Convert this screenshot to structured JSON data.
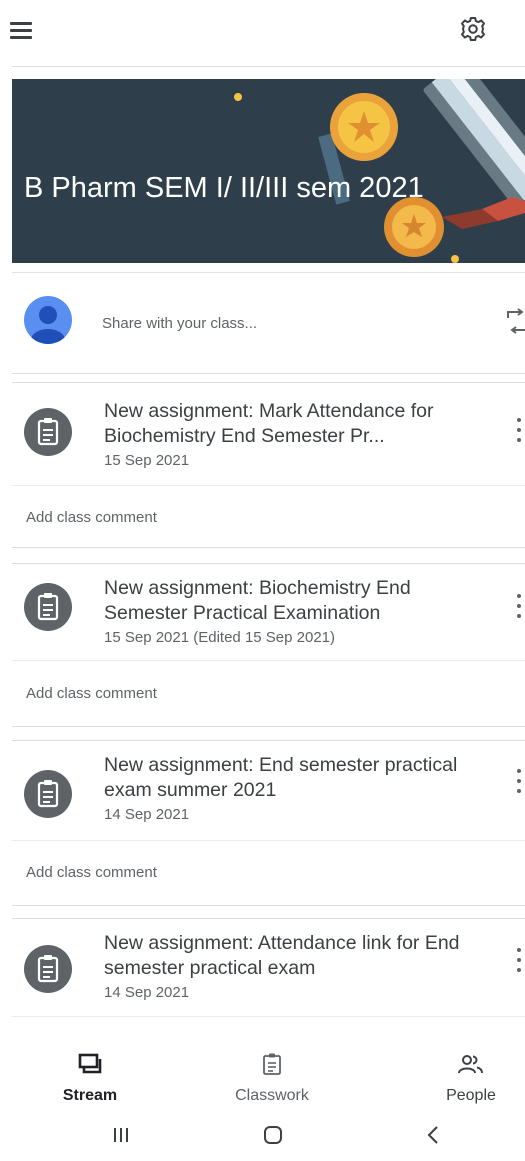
{
  "header": {
    "menu_icon": "menu-icon",
    "settings_icon": "gear-icon"
  },
  "banner": {
    "title": "B Pharm SEM I/ II/III sem 2021",
    "background_color": "#2f3e4b"
  },
  "share": {
    "placeholder": "Share with your class...",
    "avatar_icon": "default-avatar-icon",
    "repost_icon": "repost-icon"
  },
  "posts": [
    {
      "title": "New assignment: Mark Attendance for Biochemistry End Semester Pr...",
      "date": "15 Sep 2021",
      "comment_label": "Add class comment"
    },
    {
      "title": "New assignment: Biochemistry End Semester Practical Examination",
      "date": "15 Sep 2021 (Edited 15 Sep 2021)",
      "comment_label": "Add class comment"
    },
    {
      "title": "New assignment: End semester practical exam summer 2021",
      "date": "14 Sep 2021",
      "comment_label": "Add class comment"
    },
    {
      "title": "New assignment: Attendance link for End semester practical exam",
      "date": "14 Sep 2021"
    }
  ],
  "bottom_nav": {
    "items": [
      {
        "label": "Stream",
        "icon": "stream-icon",
        "active": true
      },
      {
        "label": "Classwork",
        "icon": "classwork-icon",
        "active": false
      },
      {
        "label": "People",
        "icon": "people-icon",
        "active": false
      }
    ]
  },
  "system_nav": {
    "recents_icon": "recents-icon",
    "home_icon": "home-icon",
    "back_icon": "back-icon"
  },
  "colors": {
    "primary_text": "#3c4043",
    "secondary_text": "#5f6368",
    "avatar": "#5b8ef1",
    "banner": "#2f3e4b"
  }
}
